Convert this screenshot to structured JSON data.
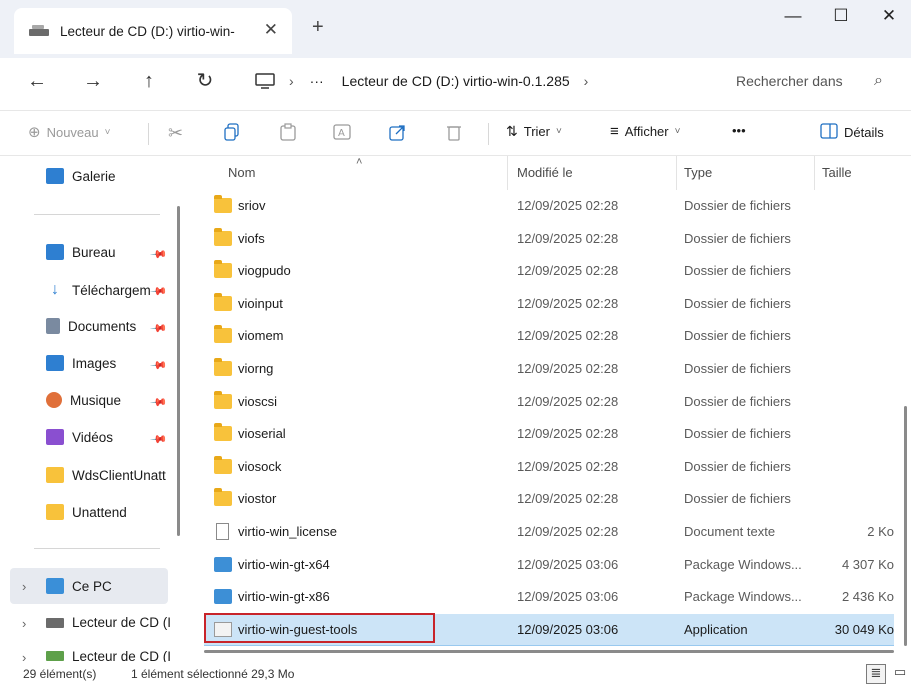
{
  "window": {
    "tab_title": "Lecteur de CD (D:) virtio-win-",
    "tab_close": "✕",
    "new_tab": "+",
    "minimize": "—",
    "maximize": "☐",
    "close": "✕"
  },
  "nav": {
    "back": "←",
    "forward": "→",
    "up": "↑",
    "refresh": "↻",
    "breadcrumb_sep1": "›",
    "breadcrumb_more": "···",
    "path": "Lecteur de CD (D:) virtio-win-0.1.285",
    "breadcrumb_sep2": "›",
    "search_placeholder": "Rechercher dans",
    "search_icon": "⌕"
  },
  "commands": {
    "new_label": "Nouveau",
    "sort_label": "Trier",
    "view_label": "Afficher",
    "more_label": "•••",
    "details_label": "Détails"
  },
  "sidebar": {
    "gallery": "Galerie",
    "pinned": [
      {
        "label": "Bureau",
        "icon": "desktop-icon",
        "color": "#2e7fd1"
      },
      {
        "label": "Téléchargem",
        "icon": "download-icon",
        "color": "#2e7fd1"
      },
      {
        "label": "Documents",
        "icon": "documents-icon",
        "color": "#7a8aa0"
      },
      {
        "label": "Images",
        "icon": "images-icon",
        "color": "#2e7fd1"
      },
      {
        "label": "Musique",
        "icon": "music-icon",
        "color": "#e0703a"
      },
      {
        "label": "Vidéos",
        "icon": "videos-icon",
        "color": "#8a4fd0"
      }
    ],
    "folders": [
      "WdsClientUnatt",
      "Unattend"
    ],
    "this_pc": "Ce PC",
    "drive1": "Lecteur de CD (I",
    "drive2": "Lecteur de CD (I"
  },
  "columns": {
    "name": "Nom",
    "modified": "Modifié le",
    "type": "Type",
    "size": "Taille"
  },
  "files": [
    {
      "name": "sriov",
      "modified": "12/09/2025 02:28",
      "type": "Dossier de fichiers",
      "size": "",
      "kind": "folder"
    },
    {
      "name": "viofs",
      "modified": "12/09/2025 02:28",
      "type": "Dossier de fichiers",
      "size": "",
      "kind": "folder"
    },
    {
      "name": "viogpudo",
      "modified": "12/09/2025 02:28",
      "type": "Dossier de fichiers",
      "size": "",
      "kind": "folder"
    },
    {
      "name": "vioinput",
      "modified": "12/09/2025 02:28",
      "type": "Dossier de fichiers",
      "size": "",
      "kind": "folder"
    },
    {
      "name": "viomem",
      "modified": "12/09/2025 02:28",
      "type": "Dossier de fichiers",
      "size": "",
      "kind": "folder"
    },
    {
      "name": "viorng",
      "modified": "12/09/2025 02:28",
      "type": "Dossier de fichiers",
      "size": "",
      "kind": "folder"
    },
    {
      "name": "vioscsi",
      "modified": "12/09/2025 02:28",
      "type": "Dossier de fichiers",
      "size": "",
      "kind": "folder"
    },
    {
      "name": "vioserial",
      "modified": "12/09/2025 02:28",
      "type": "Dossier de fichiers",
      "size": "",
      "kind": "folder"
    },
    {
      "name": "viosock",
      "modified": "12/09/2025 02:28",
      "type": "Dossier de fichiers",
      "size": "",
      "kind": "folder"
    },
    {
      "name": "viostor",
      "modified": "12/09/2025 02:28",
      "type": "Dossier de fichiers",
      "size": "",
      "kind": "folder"
    },
    {
      "name": "virtio-win_license",
      "modified": "12/09/2025 02:28",
      "type": "Document texte",
      "size": "2 Ko",
      "kind": "doc"
    },
    {
      "name": "virtio-win-gt-x64",
      "modified": "12/09/2025 03:06",
      "type": "Package Windows...",
      "size": "4 307 Ko",
      "kind": "pkg"
    },
    {
      "name": "virtio-win-gt-x86",
      "modified": "12/09/2025 03:06",
      "type": "Package Windows...",
      "size": "2 436 Ko",
      "kind": "pkg"
    },
    {
      "name": "virtio-win-guest-tools",
      "modified": "12/09/2025 03:06",
      "type": "Application",
      "size": "30 049 Ko",
      "kind": "app",
      "selected": true
    }
  ],
  "status": {
    "count": "29 élément(s)",
    "selection": "1 élément sélectionné 29,3 Mo"
  }
}
